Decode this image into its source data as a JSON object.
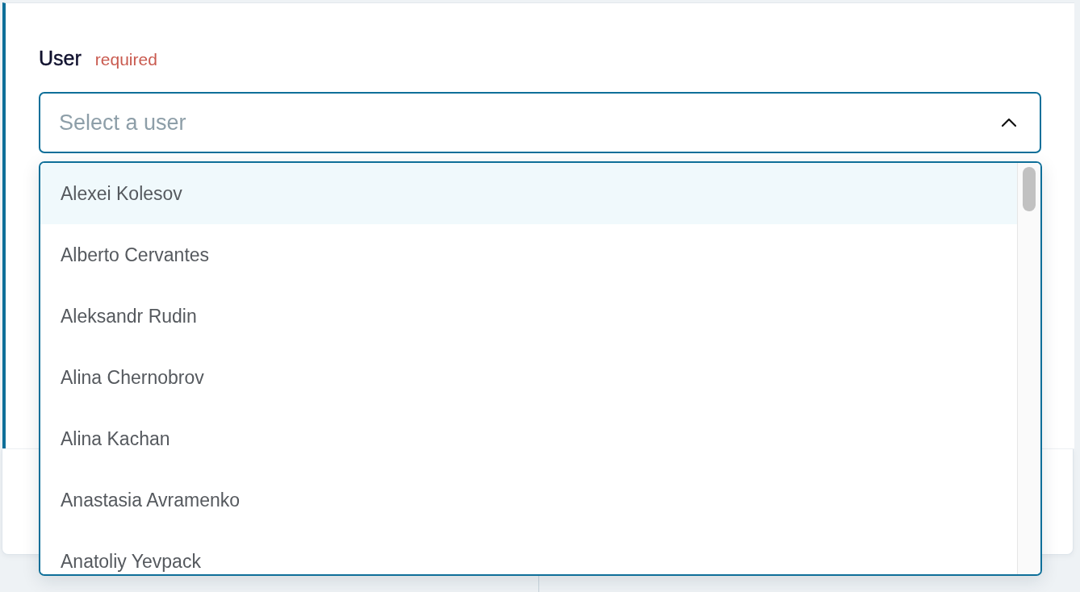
{
  "field": {
    "label": "User",
    "required_label": "required",
    "placeholder": "Select a user",
    "expanded": true
  },
  "options": [
    {
      "label": "Alexei Kolesov",
      "highlighted": true
    },
    {
      "label": "Alberto Cervantes",
      "highlighted": false
    },
    {
      "label": "Aleksandr Rudin",
      "highlighted": false
    },
    {
      "label": "Alina Chernobrov",
      "highlighted": false
    },
    {
      "label": "Alina Kachan",
      "highlighted": false
    },
    {
      "label": "Anastasia Avramenko",
      "highlighted": false
    },
    {
      "label": "Anatoliy Yevpack",
      "highlighted": false
    }
  ]
}
